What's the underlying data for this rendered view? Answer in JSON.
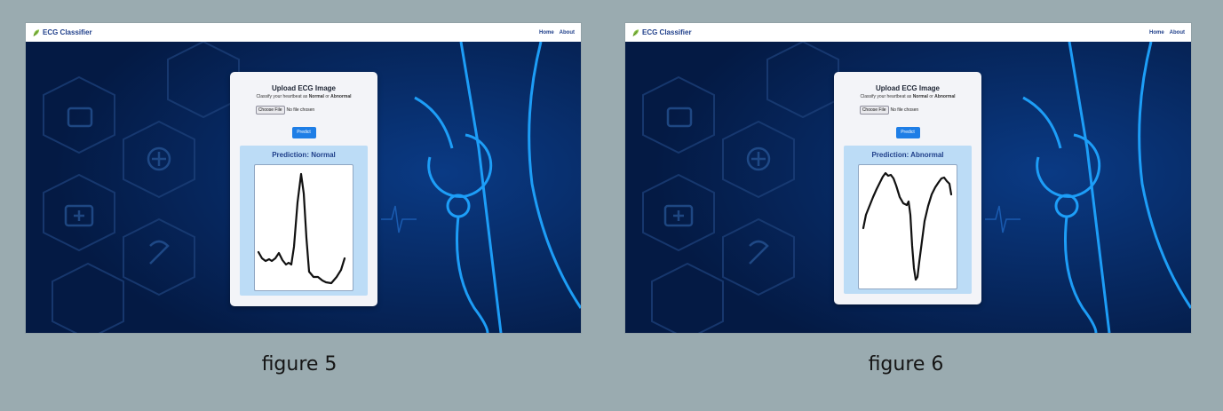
{
  "colors": {
    "page_background": "#9aabb0",
    "navbar": "#ffffff",
    "brand_text": "#1f3f8a",
    "hero_background": "#06265e",
    "hero_glow": "#1fa4ff",
    "card": "#f3f4f8",
    "predict_button": "#1e7ee6",
    "result_box": "#bcdcf6"
  },
  "icons": {
    "brand": "leaf-icon"
  },
  "figures": [
    {
      "caption": "figure 5",
      "app": {
        "brand": "ECG Classifier",
        "nav": [
          "Home",
          "About"
        ],
        "card": {
          "title": "Upload ECG Image",
          "subtitle_prefix": "Classify your heartbeat as",
          "subtitle_normal": "Normal",
          "subtitle_or": "or",
          "subtitle_abnormal": "Abnormal",
          "choose_file_label": "Choose File",
          "file_status": "No file chosen",
          "predict_label": "Predict",
          "prediction": "Prediction: Normal"
        }
      }
    },
    {
      "caption": "figure 6",
      "app": {
        "brand": "ECG Classifier",
        "nav": [
          "Home",
          "About"
        ],
        "card": {
          "title": "Upload ECG Image",
          "subtitle_prefix": "Classify your heartbeat as",
          "subtitle_normal": "Normal",
          "subtitle_or": "or",
          "subtitle_abnormal": "Abnormal",
          "choose_file_label": "Choose File",
          "file_status": "No file chosen",
          "predict_label": "Predict",
          "prediction": "Prediction: Abnormal"
        }
      }
    }
  ]
}
